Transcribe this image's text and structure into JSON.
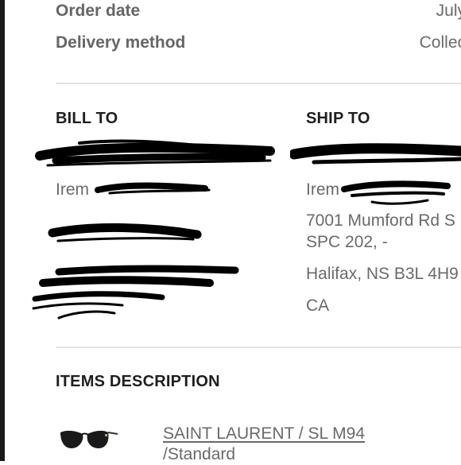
{
  "order": {
    "order_date_label": "Order date",
    "order_date_value": "July",
    "delivery_label": "Delivery method",
    "delivery_value": "Collec"
  },
  "bill_to": {
    "title": "BILL TO",
    "name_partial": "Irem"
  },
  "ship_to": {
    "title": "SHIP TO",
    "name_partial": "Irem",
    "address_line1": "7001 Mumford Rd S",
    "address_line2": "SPC 202, -",
    "city_line": "Halifax, NS B3L 4H9",
    "country": "CA"
  },
  "items": {
    "title": "ITEMS DESCRIPTION",
    "product_name": "SAINT LAURENT / SL M94",
    "product_variant": "/Standard",
    "product_image": "sunglasses-icon"
  },
  "colors": {
    "accent_dark": "#1f1f1f",
    "text_gray": "#6b6b6b",
    "divider": "#e3e3e3",
    "redaction": "#000000"
  }
}
